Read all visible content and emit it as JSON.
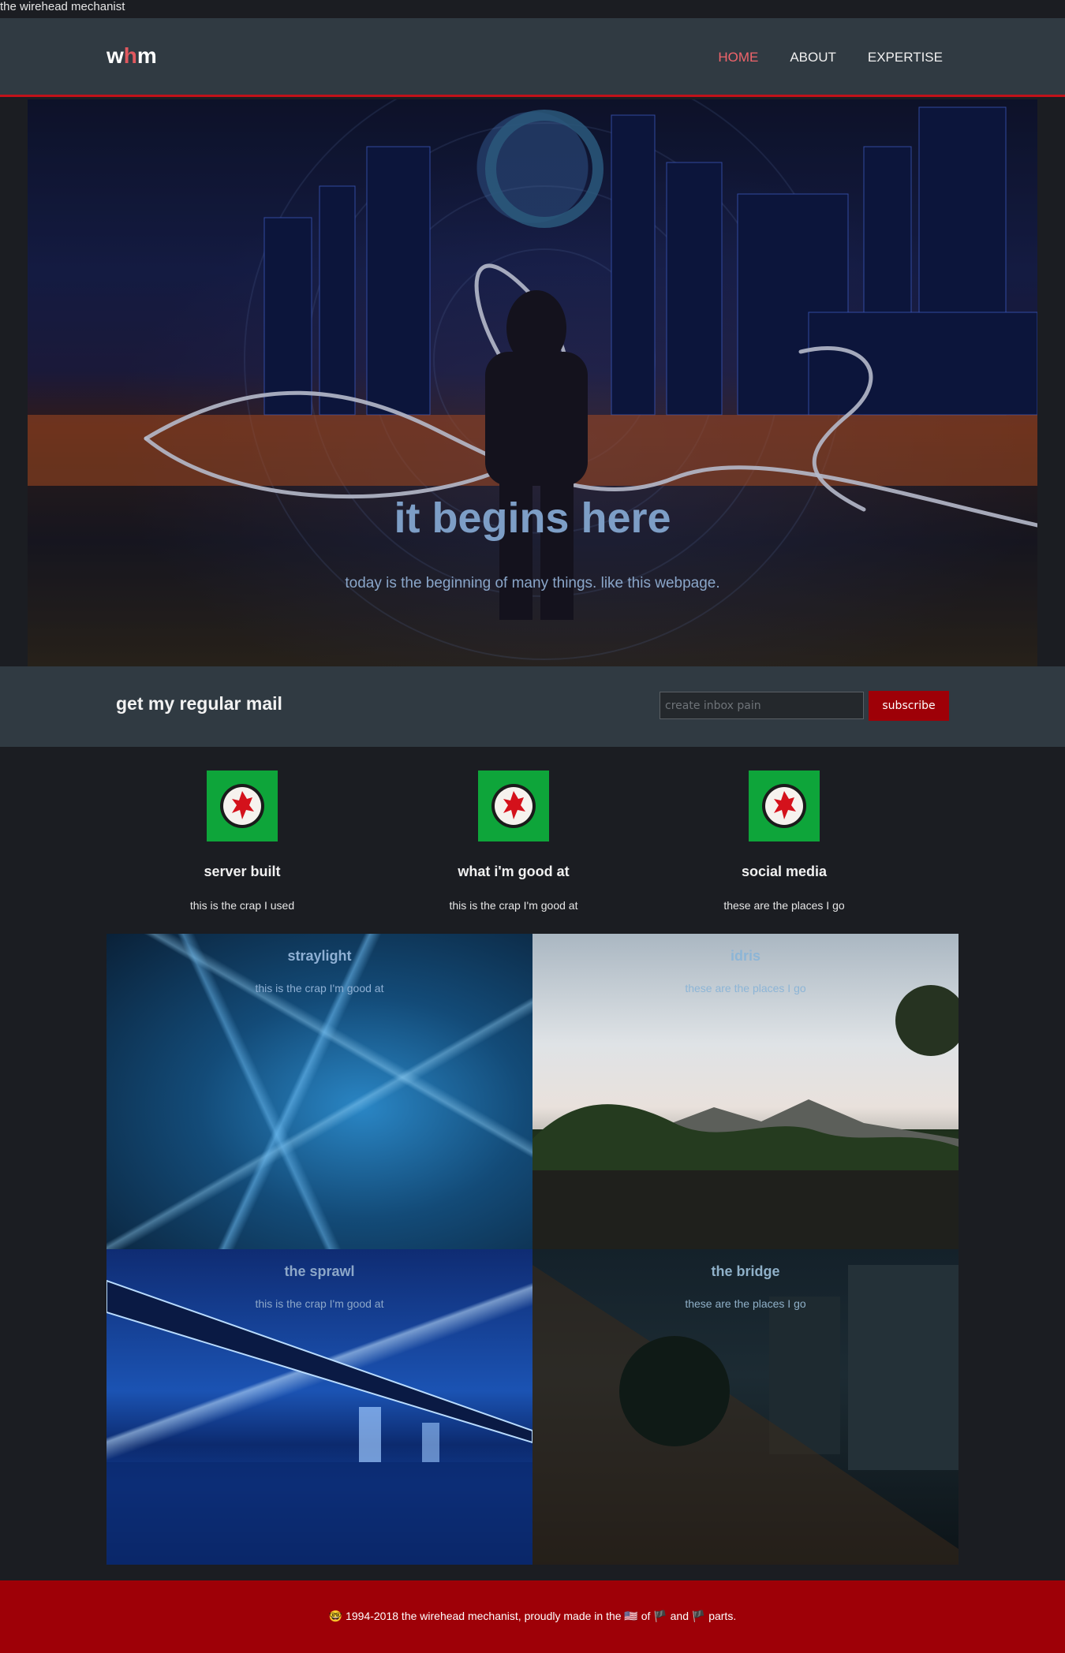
{
  "page_title": "the wirehead mechanist",
  "nav": {
    "logo": {
      "w": "w",
      "h": "h",
      "m": "m"
    },
    "items": [
      {
        "label": "HOME",
        "active": true
      },
      {
        "label": "ABOUT",
        "active": false
      },
      {
        "label": "EXPERTISE",
        "active": false
      }
    ]
  },
  "hero": {
    "title": "it begins here",
    "subtitle": "today is the beginning of many things. like this webpage."
  },
  "mail": {
    "title": "get my regular mail",
    "placeholder": "create inbox pain",
    "button": "subscribe"
  },
  "features": [
    {
      "title": "server built",
      "text": "this is the crap I used",
      "icon": "gear-logo-icon"
    },
    {
      "title": "what i'm good at",
      "text": "this is the crap I'm good at",
      "icon": "gear-logo-icon"
    },
    {
      "title": "social media",
      "text": "these are the places I go",
      "icon": "gear-logo-icon"
    }
  ],
  "tiles": [
    {
      "title": "straylight",
      "text": "this is the crap I'm good at"
    },
    {
      "title": "idris",
      "text": "these are the places I go"
    },
    {
      "title": "the sprawl",
      "text": "this is the crap I'm good at"
    },
    {
      "title": "the bridge",
      "text": "these are the places I go"
    }
  ],
  "footer": {
    "text": "🤓 1994-2018 the wirehead mechanist, proudly made in the 🇺🇸 of 🏴 and 🏴 parts."
  },
  "colors": {
    "accent_red": "#9e0007",
    "nav_active": "#f0646b",
    "feature_green": "#0ea53a"
  }
}
